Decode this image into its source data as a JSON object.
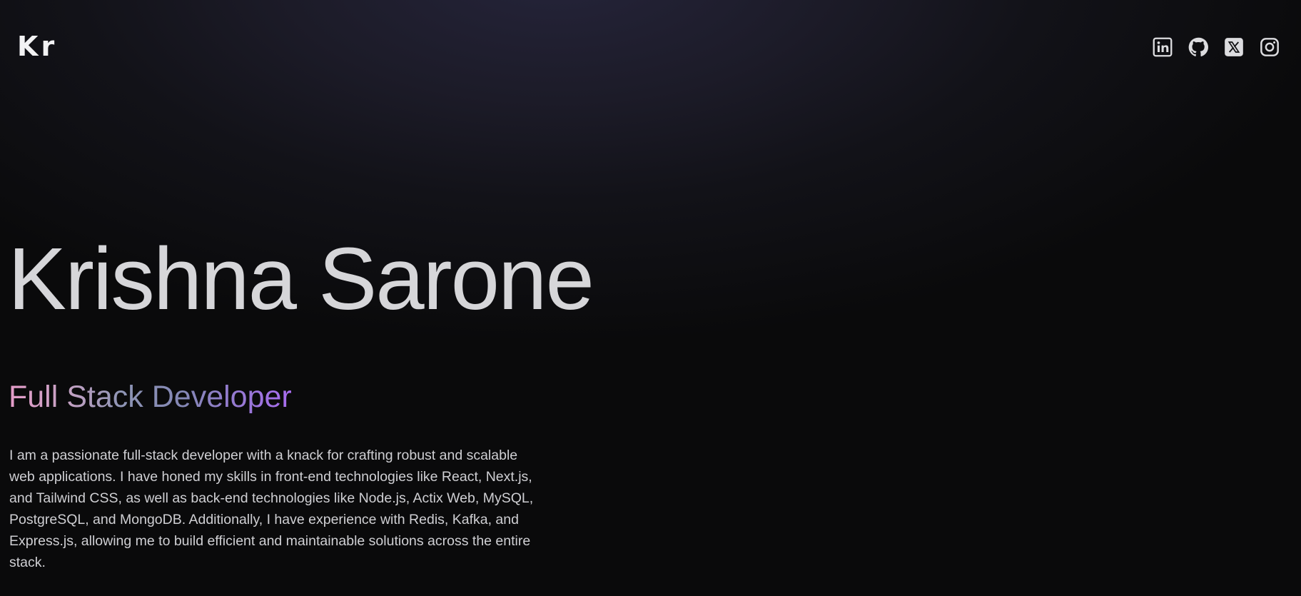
{
  "header": {
    "logo": "Kr",
    "social": [
      {
        "icon": "linkedin-icon"
      },
      {
        "icon": "github-icon"
      },
      {
        "icon": "x-icon"
      },
      {
        "icon": "instagram-icon"
      }
    ]
  },
  "hero": {
    "name": "Krishna Sarone",
    "role": "Full Stack Developer",
    "bio": "I am a passionate full-stack developer with a knack for crafting robust and scalable web applications. I have honed my skills in front-end technologies like React, Next.js, and Tailwind CSS, as well as back-end technologies like Node.js, Actix Web, MySQL, PostgreSQL, and MongoDB. Additionally, I have experience with Redis, Kafka, and Express.js, allowing me to build efficient and maintainable solutions across the entire stack."
  },
  "colors": {
    "background": "#0a0a0b",
    "text": "#d6d6d9",
    "role_gradient": [
      "#e59cc9",
      "#8e95b5",
      "#a86cf0"
    ]
  }
}
